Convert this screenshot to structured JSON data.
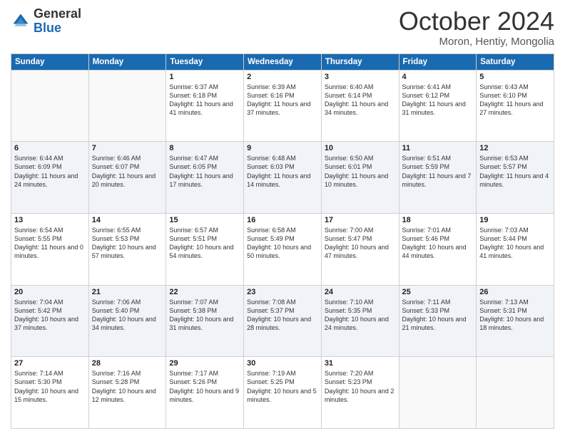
{
  "header": {
    "logo_general": "General",
    "logo_blue": "Blue",
    "month": "October 2024",
    "location": "Moron, Hentiy, Mongolia"
  },
  "weekdays": [
    "Sunday",
    "Monday",
    "Tuesday",
    "Wednesday",
    "Thursday",
    "Friday",
    "Saturday"
  ],
  "rows": [
    [
      {
        "day": "",
        "info": ""
      },
      {
        "day": "",
        "info": ""
      },
      {
        "day": "1",
        "info": "Sunrise: 6:37 AM\nSunset: 6:18 PM\nDaylight: 11 hours and 41 minutes."
      },
      {
        "day": "2",
        "info": "Sunrise: 6:39 AM\nSunset: 6:16 PM\nDaylight: 11 hours and 37 minutes."
      },
      {
        "day": "3",
        "info": "Sunrise: 6:40 AM\nSunset: 6:14 PM\nDaylight: 11 hours and 34 minutes."
      },
      {
        "day": "4",
        "info": "Sunrise: 6:41 AM\nSunset: 6:12 PM\nDaylight: 11 hours and 31 minutes."
      },
      {
        "day": "5",
        "info": "Sunrise: 6:43 AM\nSunset: 6:10 PM\nDaylight: 11 hours and 27 minutes."
      }
    ],
    [
      {
        "day": "6",
        "info": "Sunrise: 6:44 AM\nSunset: 6:09 PM\nDaylight: 11 hours and 24 minutes."
      },
      {
        "day": "7",
        "info": "Sunrise: 6:46 AM\nSunset: 6:07 PM\nDaylight: 11 hours and 20 minutes."
      },
      {
        "day": "8",
        "info": "Sunrise: 6:47 AM\nSunset: 6:05 PM\nDaylight: 11 hours and 17 minutes."
      },
      {
        "day": "9",
        "info": "Sunrise: 6:48 AM\nSunset: 6:03 PM\nDaylight: 11 hours and 14 minutes."
      },
      {
        "day": "10",
        "info": "Sunrise: 6:50 AM\nSunset: 6:01 PM\nDaylight: 11 hours and 10 minutes."
      },
      {
        "day": "11",
        "info": "Sunrise: 6:51 AM\nSunset: 5:59 PM\nDaylight: 11 hours and 7 minutes."
      },
      {
        "day": "12",
        "info": "Sunrise: 6:53 AM\nSunset: 5:57 PM\nDaylight: 11 hours and 4 minutes."
      }
    ],
    [
      {
        "day": "13",
        "info": "Sunrise: 6:54 AM\nSunset: 5:55 PM\nDaylight: 11 hours and 0 minutes."
      },
      {
        "day": "14",
        "info": "Sunrise: 6:55 AM\nSunset: 5:53 PM\nDaylight: 10 hours and 57 minutes."
      },
      {
        "day": "15",
        "info": "Sunrise: 6:57 AM\nSunset: 5:51 PM\nDaylight: 10 hours and 54 minutes."
      },
      {
        "day": "16",
        "info": "Sunrise: 6:58 AM\nSunset: 5:49 PM\nDaylight: 10 hours and 50 minutes."
      },
      {
        "day": "17",
        "info": "Sunrise: 7:00 AM\nSunset: 5:47 PM\nDaylight: 10 hours and 47 minutes."
      },
      {
        "day": "18",
        "info": "Sunrise: 7:01 AM\nSunset: 5:46 PM\nDaylight: 10 hours and 44 minutes."
      },
      {
        "day": "19",
        "info": "Sunrise: 7:03 AM\nSunset: 5:44 PM\nDaylight: 10 hours and 41 minutes."
      }
    ],
    [
      {
        "day": "20",
        "info": "Sunrise: 7:04 AM\nSunset: 5:42 PM\nDaylight: 10 hours and 37 minutes."
      },
      {
        "day": "21",
        "info": "Sunrise: 7:06 AM\nSunset: 5:40 PM\nDaylight: 10 hours and 34 minutes."
      },
      {
        "day": "22",
        "info": "Sunrise: 7:07 AM\nSunset: 5:38 PM\nDaylight: 10 hours and 31 minutes."
      },
      {
        "day": "23",
        "info": "Sunrise: 7:08 AM\nSunset: 5:37 PM\nDaylight: 10 hours and 28 minutes."
      },
      {
        "day": "24",
        "info": "Sunrise: 7:10 AM\nSunset: 5:35 PM\nDaylight: 10 hours and 24 minutes."
      },
      {
        "day": "25",
        "info": "Sunrise: 7:11 AM\nSunset: 5:33 PM\nDaylight: 10 hours and 21 minutes."
      },
      {
        "day": "26",
        "info": "Sunrise: 7:13 AM\nSunset: 5:31 PM\nDaylight: 10 hours and 18 minutes."
      }
    ],
    [
      {
        "day": "27",
        "info": "Sunrise: 7:14 AM\nSunset: 5:30 PM\nDaylight: 10 hours and 15 minutes."
      },
      {
        "day": "28",
        "info": "Sunrise: 7:16 AM\nSunset: 5:28 PM\nDaylight: 10 hours and 12 minutes."
      },
      {
        "day": "29",
        "info": "Sunrise: 7:17 AM\nSunset: 5:26 PM\nDaylight: 10 hours and 9 minutes."
      },
      {
        "day": "30",
        "info": "Sunrise: 7:19 AM\nSunset: 5:25 PM\nDaylight: 10 hours and 5 minutes."
      },
      {
        "day": "31",
        "info": "Sunrise: 7:20 AM\nSunset: 5:23 PM\nDaylight: 10 hours and 2 minutes."
      },
      {
        "day": "",
        "info": ""
      },
      {
        "day": "",
        "info": ""
      }
    ]
  ]
}
